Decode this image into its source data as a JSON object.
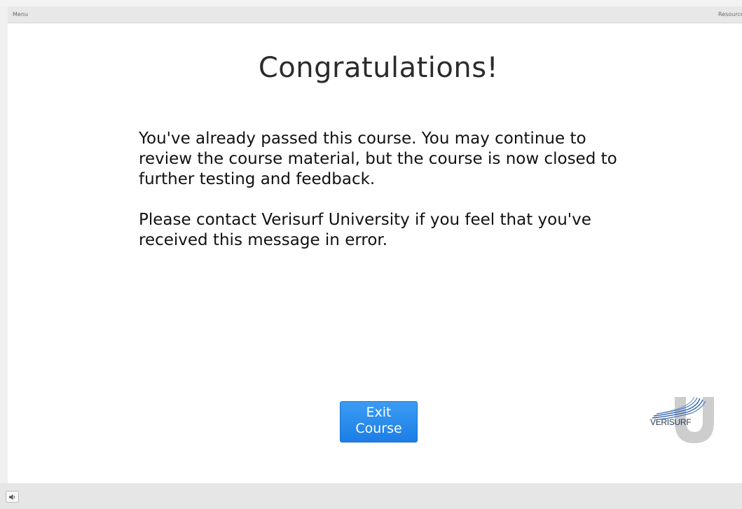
{
  "tabs": {
    "menu_label": "Menu",
    "resources_label": "Resources"
  },
  "slide": {
    "title": "Congratulations!",
    "paragraph_1": "You've already passed this course. You may continue to review the course material, but the course is now closed to further testing and feedback.",
    "paragraph_2": "Please contact Verisurf University if you feel that you've received this message in error.",
    "exit_button_line_1": "Exit",
    "exit_button_line_2": "Course"
  },
  "logo": {
    "brand_text": "VERISURF",
    "colors": {
      "letter_u": "#c9c9c9",
      "waves": "#2d5fa8",
      "text": "#2a3b55"
    }
  },
  "controls": {
    "volume_icon": "speaker-icon"
  },
  "colors": {
    "button_blue": "#1c7ee6",
    "chrome_gray": "#e6e6e6"
  }
}
